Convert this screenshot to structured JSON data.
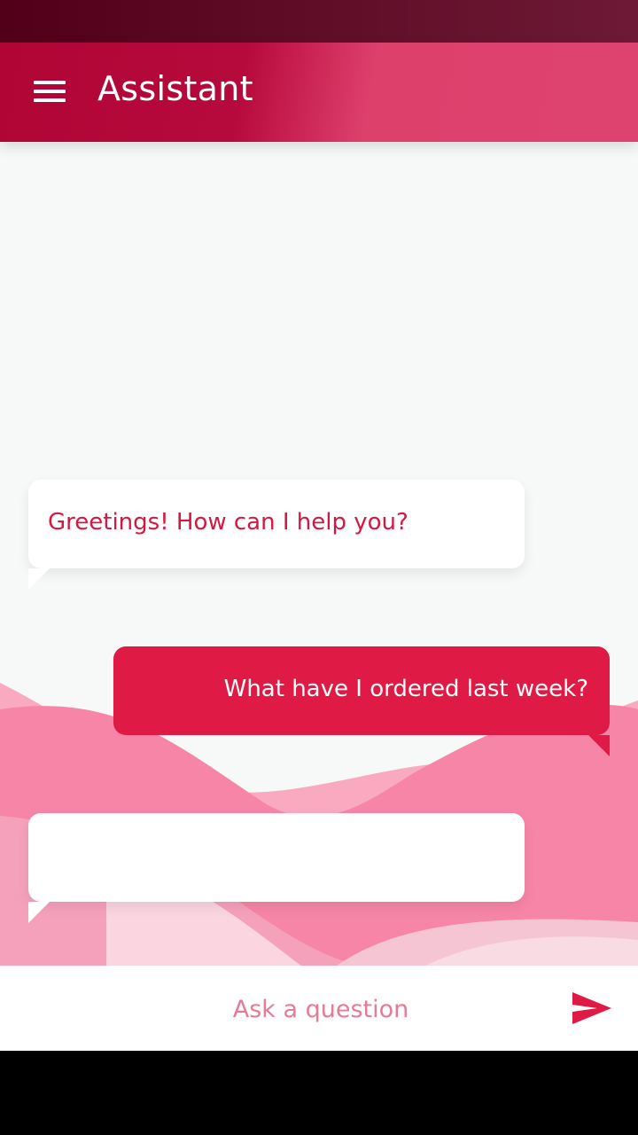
{
  "app": {
    "title": "Assistant"
  },
  "colors": {
    "primary": "#df1a44",
    "header_dark": "#b10536",
    "header_light": "#de426e",
    "status_bar": "#52001a",
    "bot_text": "#d4183f",
    "placeholder": "#e77a94",
    "wave_pink": "#f77ea0"
  },
  "icons": {
    "menu": "hamburger-icon",
    "send": "send-icon"
  },
  "messages": [
    {
      "sender": "bot",
      "text": "Greetings! How can I help you?"
    },
    {
      "sender": "user",
      "text": "What have I ordered last week?"
    },
    {
      "sender": "bot",
      "text": ""
    }
  ],
  "input": {
    "placeholder": "Ask a question",
    "value": ""
  }
}
